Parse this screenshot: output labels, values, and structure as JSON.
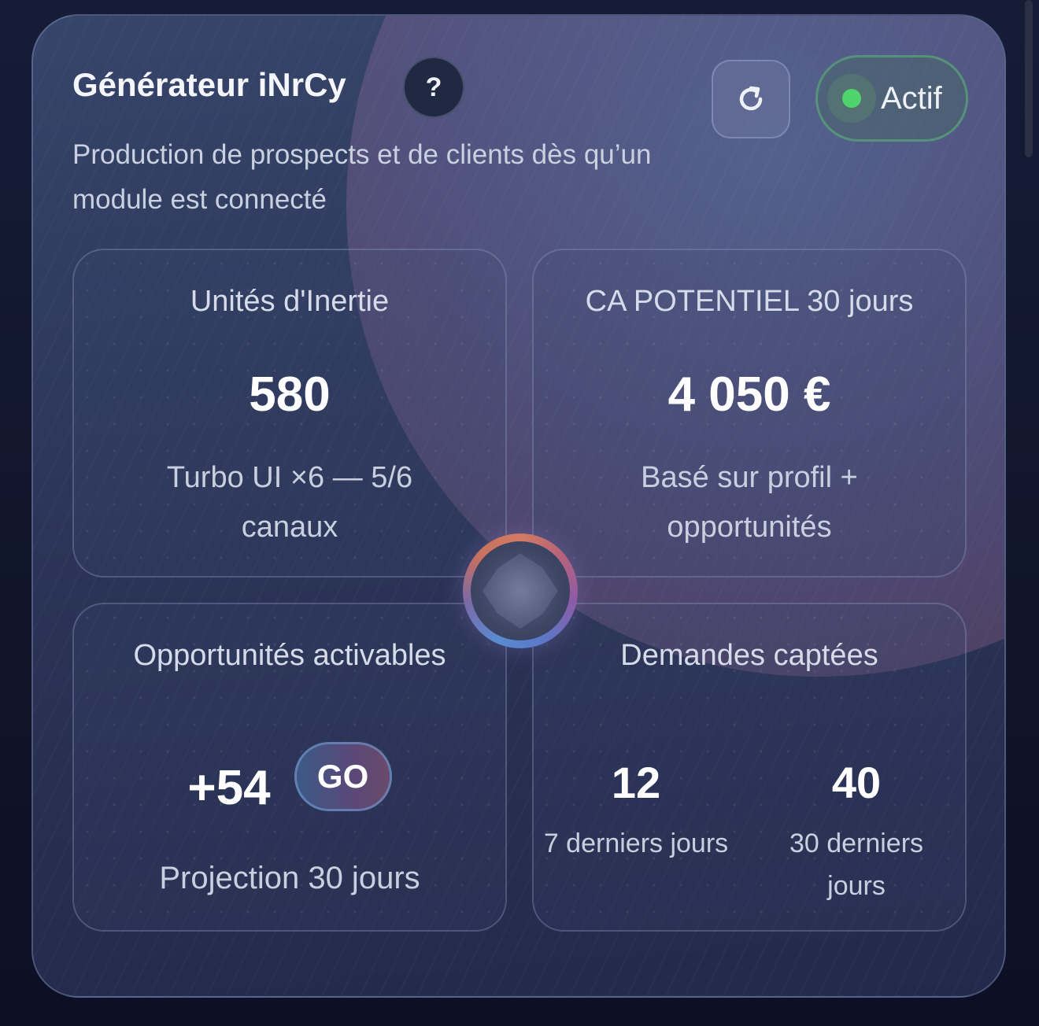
{
  "header": {
    "title": "Générateur iNrCy",
    "help_label": "?",
    "subtitle": "Production de prospects et de clients dès qu’un module est connecté",
    "status_label": "Actif",
    "refresh_icon": "refresh-icon"
  },
  "tiles": {
    "inertia": {
      "label": "Unités d'Inertie",
      "value": "580",
      "note": "Turbo UI ×6 — 5/6 canaux"
    },
    "revenue": {
      "label": "CA POTENTIEL 30 jours",
      "value": "4 050 €",
      "note": "Basé sur profil + opportunités"
    },
    "opportunities": {
      "label": "Opportunités activables",
      "value": "+54",
      "go_label": "GO",
      "note": "Projection 30 jours"
    },
    "requests": {
      "label": "Demandes captées",
      "week_value": "12",
      "week_note": "7 derniers jours",
      "month_value": "40",
      "month_note": "30 derniers jours"
    }
  },
  "colors": {
    "status_active": "#4fd36d",
    "card_bg": "#2c3658",
    "accent_orb": "#8b5ca8"
  }
}
